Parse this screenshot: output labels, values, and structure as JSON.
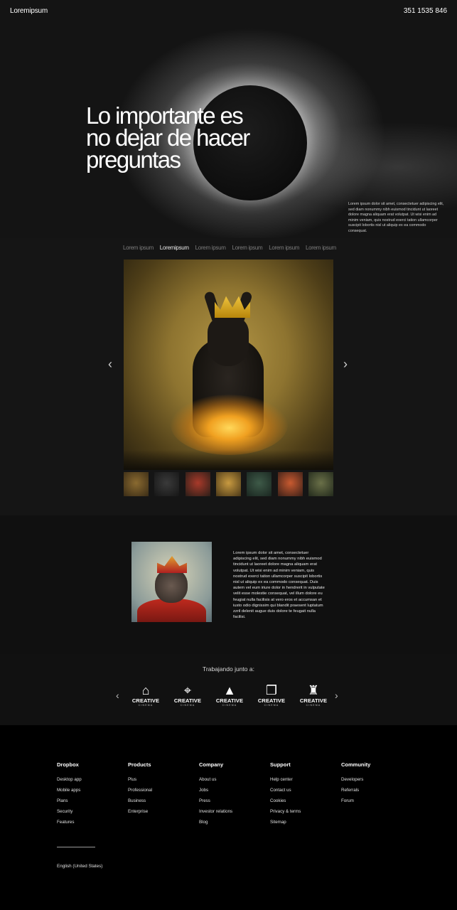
{
  "header": {
    "brand": "Loremipsum",
    "phone": "351 1535 846"
  },
  "hero": {
    "headline": "Lo importante es no dejar de hacer preguntas",
    "paragraph": "Lorem ipsum dolor sit amet, consectetuer adipiscing elit, sed diam nonummy nibh euismod tincidunt ut laoreet dolore magna aliquam erat volutpat. Ut wisi enim ad minim veniam, quis nostrud exerci tation ullamcorper suscipit lobortis nisl ut aliquip ex ea commodo consequat."
  },
  "gallery": {
    "tabs": [
      {
        "label": "Lorem ipsum"
      },
      {
        "label": "Loremipsum"
      },
      {
        "label": "Lorem ipsum"
      },
      {
        "label": "Lorem ipsum"
      },
      {
        "label": "Lorem ipsum"
      },
      {
        "label": "Lorem ipsum"
      }
    ],
    "prev_icon": "chevron-left-icon",
    "next_icon": "chevron-right-icon",
    "thumbnails": [
      "dog-crown-thumb",
      "raven-thumb",
      "monkey-king-thumb",
      "dog-fire-thumb",
      "green-figure-thumb",
      "fox-crown-thumb",
      "hill-figure-thumb"
    ]
  },
  "feature": {
    "text": "Lorem ipsum dolor sit amet, consectetuer adipiscing elit, sed diam nonummy nibh euismod tincidunt ut laoreet dolore magna aliquam erat volutpat. Ut wisi enim ad minim veniam, quis nostrud exerci tation ullamcorper suscipit lobortis nisl ut aliquip ex ea commodo consequat. Duis autem vel eum iriure dolor in hendrerit in vulputate velit esse molestie consequat, vel illum dolore eu feugiat nulla facilisis at vero eros et accumsan et iusto odio dignissim qui blandit praesent luptatum zzril delenit augue duis dolore te feugait nulla facilisi."
  },
  "partners": {
    "title": "Trabajando junto a:",
    "logos": [
      {
        "icon": "hanger-icon",
        "glyph": "⌂",
        "word": "CREATIVE",
        "sub": "CINEMA"
      },
      {
        "icon": "map-pin-icon",
        "glyph": "⌖",
        "word": "CREATIVE",
        "sub": "CINEMA"
      },
      {
        "icon": "graduation-cap-icon",
        "glyph": "▲",
        "word": "CREATIVE",
        "sub": "CINEMA"
      },
      {
        "icon": "book-icon",
        "glyph": "❐",
        "word": "CREATIVE",
        "sub": "CINEMA"
      },
      {
        "icon": "armchair-icon",
        "glyph": "♜",
        "word": "CREATIVE",
        "sub": "CINEMA"
      }
    ]
  },
  "footer": {
    "columns": [
      {
        "title": "Dropbox",
        "links": [
          "Desktop app",
          "Mobile apps",
          "Plans",
          "Security",
          "Features"
        ]
      },
      {
        "title": "Products",
        "links": [
          "Plus",
          "Professional",
          "Business",
          "Enterprise"
        ]
      },
      {
        "title": "Company",
        "links": [
          "About us",
          "Jobs",
          "Press",
          "Investor relations",
          "Blog"
        ]
      },
      {
        "title": "Support",
        "links": [
          "Help center",
          "Contact us",
          "Cookies",
          "Privacy & terms",
          "Sitemap"
        ]
      },
      {
        "title": "Community",
        "links": [
          "Developers",
          "Referrals",
          "Forum"
        ]
      }
    ],
    "language": "English (United States)"
  }
}
